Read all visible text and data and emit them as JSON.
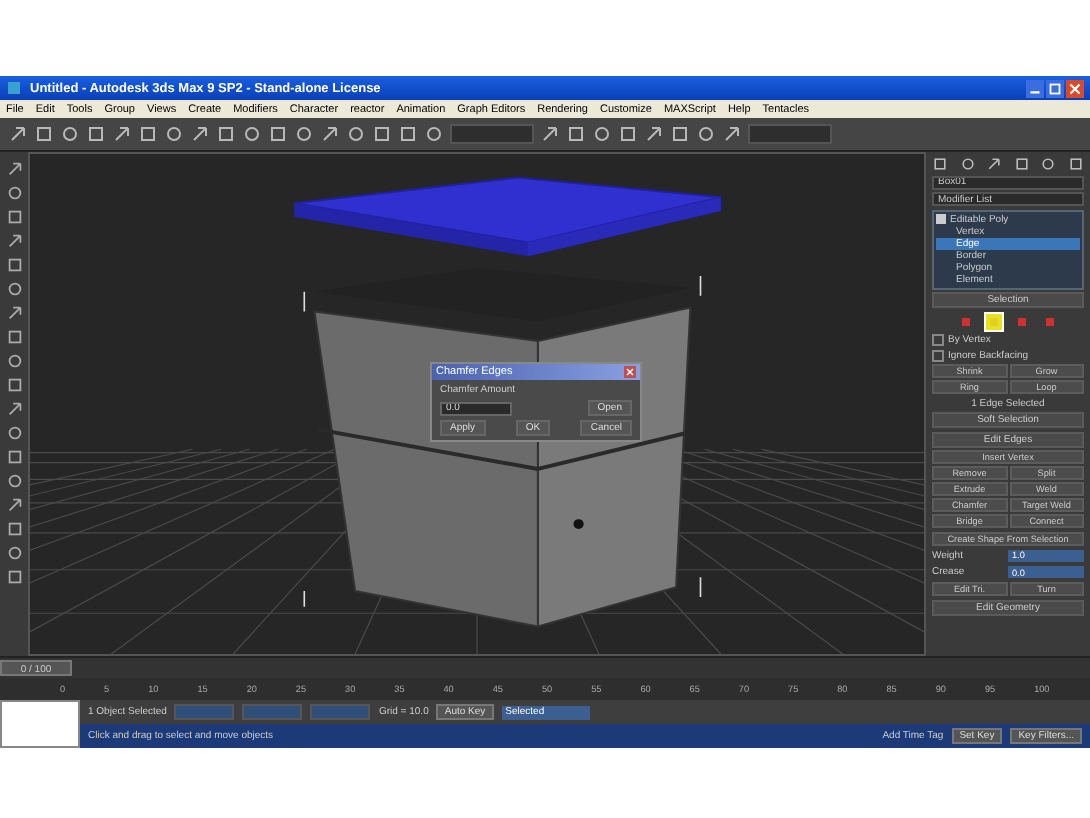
{
  "window": {
    "title": "Untitled - Autodesk 3ds Max 9 SP2 - Stand-alone License"
  },
  "menu": [
    "File",
    "Edit",
    "Tools",
    "Group",
    "Views",
    "Create",
    "Modifiers",
    "Character",
    "reactor",
    "Animation",
    "Graph Editors",
    "Rendering",
    "Customize",
    "MAXScript",
    "Help",
    "Tentacles"
  ],
  "dialog": {
    "title": "Chamfer Edges",
    "label": "Chamfer Amount",
    "value": "0.0",
    "side_button": "Open",
    "buttons": [
      "Apply",
      "OK",
      "Cancel"
    ]
  },
  "command_panel": {
    "object_name": "Box01",
    "modifier_list": "Modifier List",
    "stack": [
      {
        "label": "Editable Poly",
        "expanded": true,
        "children": [
          {
            "label": "Vertex",
            "selected": false
          },
          {
            "label": "Edge",
            "selected": true
          },
          {
            "label": "Border",
            "selected": false
          },
          {
            "label": "Polygon",
            "selected": false
          },
          {
            "label": "Element",
            "selected": false
          }
        ]
      }
    ],
    "selection": {
      "title": "Selection",
      "modes": [
        {
          "kind": "vertex",
          "selected": false
        },
        {
          "kind": "edge",
          "selected": true
        },
        {
          "kind": "border",
          "selected": false
        },
        {
          "kind": "polygon",
          "selected": false
        }
      ],
      "options": [
        {
          "label": "By Vertex",
          "checked": false
        },
        {
          "label": "Ignore Backfacing",
          "checked": false
        }
      ],
      "buttons": [
        "Shrink",
        "Grow",
        "Ring",
        "Loop"
      ],
      "status": "1 Edge Selected"
    },
    "rollouts": [
      "Soft Selection",
      "Edit Edges"
    ],
    "edit_buttons": [
      "Insert Vertex",
      "Remove",
      "Split",
      "Extrude",
      "Weld",
      "Chamfer",
      "Target Weld",
      "Bridge",
      "Connect"
    ],
    "shape_button": "Create Shape From Selection",
    "fields": [
      {
        "label": "Weight",
        "value": "1.0"
      },
      {
        "label": "Crease",
        "value": "0.0"
      }
    ],
    "tri_buttons": [
      "Edit Tri.",
      "Turn"
    ],
    "last_rollout": "Edit Geometry"
  },
  "time_slider": {
    "label": "0 / 100",
    "level": 0
  },
  "ticks": [
    "0",
    "5",
    "10",
    "15",
    "20",
    "25",
    "30",
    "35",
    "40",
    "45",
    "50",
    "55",
    "60",
    "65",
    "70",
    "75",
    "80",
    "85",
    "90",
    "95",
    "100"
  ],
  "status_bar": {
    "selected": "1 Object Selected",
    "prompt": "Click and drag to select and move objects",
    "grid": "Grid = 10.0",
    "add_time_tag": "Add Time Tag",
    "auto_key": "Auto Key",
    "key_mode": "Selected",
    "set_key": "Set Key",
    "key_filters": "Key Filters..."
  }
}
